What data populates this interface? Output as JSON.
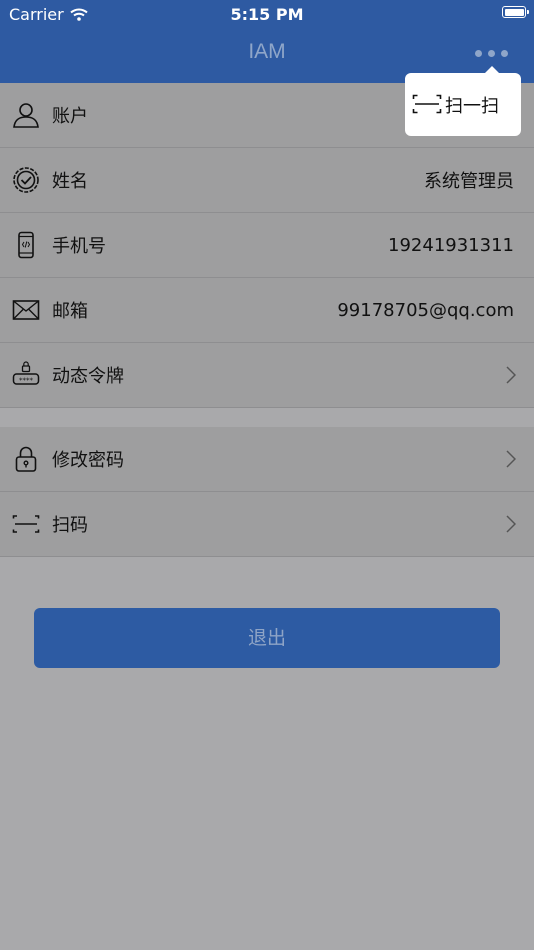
{
  "status_bar": {
    "carrier": "Carrier",
    "time": "5:15 PM"
  },
  "nav": {
    "title": "IAM"
  },
  "popup": {
    "scan_label": "扫一扫"
  },
  "info_rows": [
    {
      "label": "账户",
      "value": "",
      "icon": "user-icon"
    },
    {
      "label": "姓名",
      "value": "系统管理员",
      "icon": "verified-badge-icon"
    },
    {
      "label": "手机号",
      "value": "19241931311",
      "icon": "phone-icon"
    },
    {
      "label": "邮箱",
      "value": "99178705@qq.com",
      "icon": "mail-icon"
    },
    {
      "label": "动态令牌",
      "value": "",
      "icon": "token-icon"
    }
  ],
  "action_rows": [
    {
      "label": "修改密码",
      "icon": "lock-icon"
    },
    {
      "label": "扫码",
      "icon": "scan-icon"
    }
  ],
  "logout_label": "退出",
  "colors": {
    "brand_blue": "#2e5aa2",
    "overlay_gray": "#a9a9ab"
  }
}
